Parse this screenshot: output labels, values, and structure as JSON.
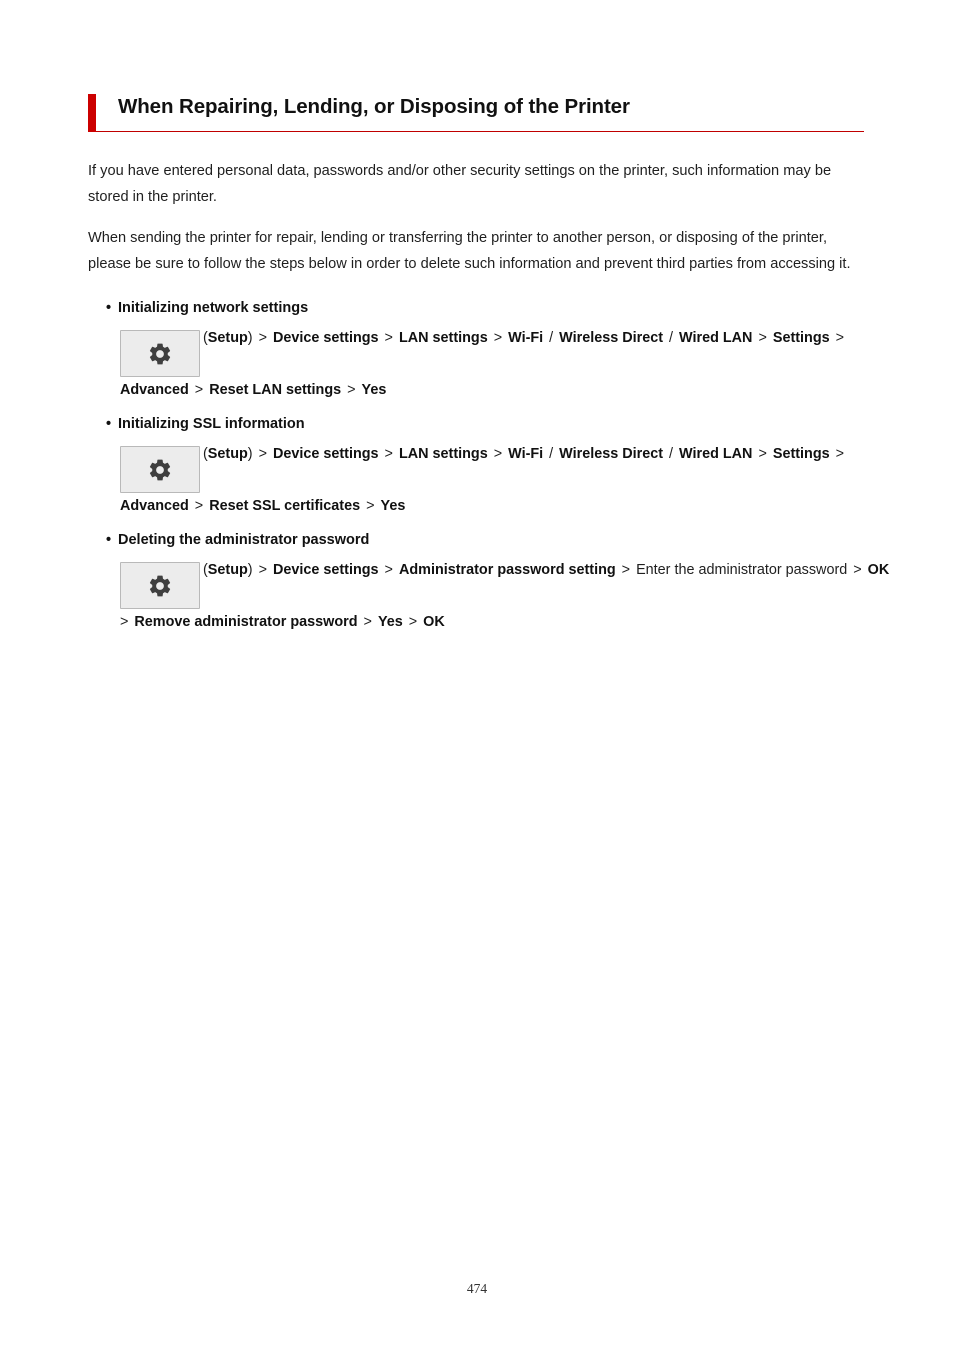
{
  "document": {
    "page_number": "474",
    "accent_color": "#cc0000",
    "rule_color": "#c00000",
    "background": "#ffffff"
  },
  "heading": {
    "title": "When Repairing, Lending, or Disposing of the Printer"
  },
  "paragraphs": [
    "If you have entered personal data, passwords and/or other security settings on the printer, such information may be stored in the printer.",
    "When sending the printer for repair, lending or transferring the printer to another person, or disposing of the printer, please be sure to follow the steps below in order to delete such information and prevent third parties from accessing it."
  ],
  "sections": [
    {
      "title": "Initializing network settings",
      "icon": "gear-icon",
      "icon_label": "Setup",
      "path_parts": [
        {
          "text": "(",
          "bold": false
        },
        {
          "text": "Setup",
          "bold": true
        },
        {
          "text": ")",
          "bold": false
        },
        {
          "text": " > ",
          "bold": false
        },
        {
          "text": "Device settings",
          "bold": true
        },
        {
          "text": " > ",
          "bold": false
        },
        {
          "text": "LAN settings",
          "bold": true
        },
        {
          "text": " > ",
          "bold": false
        },
        {
          "text": "Wi-Fi",
          "bold": true
        },
        {
          "text": " / ",
          "bold": false
        },
        {
          "text": "Wireless Direct",
          "bold": true
        },
        {
          "text": " / ",
          "bold": false
        },
        {
          "text": "Wired LAN",
          "bold": true
        },
        {
          "text": " > ",
          "bold": false
        },
        {
          "text": "Settings",
          "bold": true
        },
        {
          "text": " > ",
          "bold": false
        },
        {
          "text": "Advanced",
          "bold": true
        },
        {
          "text": " > ",
          "bold": false
        },
        {
          "text": "Reset LAN settings",
          "bold": true
        },
        {
          "text": " > ",
          "bold": false
        },
        {
          "text": "Yes",
          "bold": true
        }
      ]
    },
    {
      "title": "Initializing SSL information",
      "icon": "gear-icon",
      "icon_label": "Setup",
      "path_parts": [
        {
          "text": "(",
          "bold": false
        },
        {
          "text": "Setup",
          "bold": true
        },
        {
          "text": ")",
          "bold": false
        },
        {
          "text": " > ",
          "bold": false
        },
        {
          "text": "Device settings",
          "bold": true
        },
        {
          "text": " > ",
          "bold": false
        },
        {
          "text": "LAN settings",
          "bold": true
        },
        {
          "text": " > ",
          "bold": false
        },
        {
          "text": "Wi-Fi",
          "bold": true
        },
        {
          "text": " / ",
          "bold": false
        },
        {
          "text": "Wireless Direct",
          "bold": true
        },
        {
          "text": " / ",
          "bold": false
        },
        {
          "text": "Wired LAN",
          "bold": true
        },
        {
          "text": " > ",
          "bold": false
        },
        {
          "text": "Settings",
          "bold": true
        },
        {
          "text": " > ",
          "bold": false
        },
        {
          "text": "Advanced",
          "bold": true
        },
        {
          "text": " > ",
          "bold": false
        },
        {
          "text": "Reset SSL certificates",
          "bold": true
        },
        {
          "text": " > ",
          "bold": false
        },
        {
          "text": "Yes",
          "bold": true
        }
      ]
    },
    {
      "title": "Deleting the administrator password",
      "icon": "gear-icon",
      "icon_label": "Setup",
      "path_parts": [
        {
          "text": "(",
          "bold": false
        },
        {
          "text": "Setup",
          "bold": true
        },
        {
          "text": ")",
          "bold": false
        },
        {
          "text": " > ",
          "bold": false
        },
        {
          "text": "Device settings",
          "bold": true
        },
        {
          "text": " > ",
          "bold": false
        },
        {
          "text": "Administrator password setting",
          "bold": true
        },
        {
          "text": " > ",
          "bold": false
        },
        {
          "text": "Enter the administrator password",
          "bold": false
        },
        {
          "text": " > ",
          "bold": false
        },
        {
          "text": "OK",
          "bold": true
        },
        {
          "text": " > ",
          "bold": false
        },
        {
          "text": "Remove administrator password",
          "bold": true
        },
        {
          "text": " > ",
          "bold": false
        },
        {
          "text": "Yes",
          "bold": true
        },
        {
          "text": " > ",
          "bold": false
        },
        {
          "text": "OK",
          "bold": true
        }
      ]
    }
  ]
}
